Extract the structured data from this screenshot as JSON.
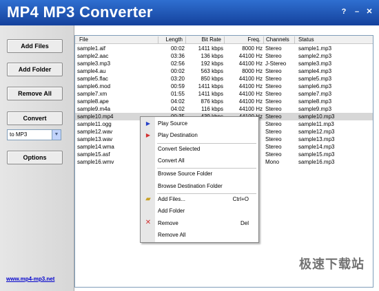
{
  "window": {
    "title": "MP4 MP3 Converter",
    "help_label": "?",
    "minimize_label": "–",
    "close_label": "✕"
  },
  "sidebar": {
    "add_files": "Add Files",
    "add_folder": "Add Folder",
    "remove_all": "Remove All",
    "convert": "Convert",
    "format_selected": "to MP3",
    "options": "Options",
    "website": "www.mp4-mp3.net"
  },
  "table": {
    "columns": [
      "File",
      "Length",
      "Bit Rate",
      "Freq.",
      "Channels",
      "Status"
    ],
    "rows": [
      {
        "file": "sample1.aif",
        "length": "00:02",
        "bitrate": "1411 kbps",
        "freq": "8000 Hz",
        "channels": "Stereo",
        "status": "sample1.mp3"
      },
      {
        "file": "sample2.aac",
        "length": "03:36",
        "bitrate": "136 kbps",
        "freq": "44100 Hz",
        "channels": "Stereo",
        "status": "sample2.mp3"
      },
      {
        "file": "sample3.mp3",
        "length": "02:56",
        "bitrate": "192 kbps",
        "freq": "44100 Hz",
        "channels": "J-Stereo",
        "status": "sample3.mp3"
      },
      {
        "file": "sample4.au",
        "length": "00:02",
        "bitrate": "563 kbps",
        "freq": "8000 Hz",
        "channels": "Stereo",
        "status": "sample4.mp3"
      },
      {
        "file": "sample5.flac",
        "length": "03:20",
        "bitrate": "850 kbps",
        "freq": "44100 Hz",
        "channels": "Stereo",
        "status": "sample5.mp3"
      },
      {
        "file": "sample6.mod",
        "length": "00:59",
        "bitrate": "1411 kbps",
        "freq": "44100 Hz",
        "channels": "Stereo",
        "status": "sample6.mp3"
      },
      {
        "file": "sample7.xm",
        "length": "01:55",
        "bitrate": "1411 kbps",
        "freq": "44100 Hz",
        "channels": "Stereo",
        "status": "sample7.mp3"
      },
      {
        "file": "sample8.ape",
        "length": "04:02",
        "bitrate": "876 kbps",
        "freq": "44100 Hz",
        "channels": "Stereo",
        "status": "sample8.mp3"
      },
      {
        "file": "sample9.m4a",
        "length": "04:02",
        "bitrate": "116 kbps",
        "freq": "44100 Hz",
        "channels": "Stereo",
        "status": "sample9.mp3"
      },
      {
        "file": "sample10.mp4",
        "length": "00:35",
        "bitrate": "439 kbps",
        "freq": "44100 Hz",
        "channels": "Stereo",
        "status": "sample10.mp3"
      },
      {
        "file": "sample11.ogg",
        "length": "",
        "bitrate": "",
        "freq": "",
        "channels": "Stereo",
        "status": "sample11.mp3"
      },
      {
        "file": "sample12.wav",
        "length": "",
        "bitrate": "",
        "freq": "",
        "channels": "Stereo",
        "status": "sample12.mp3"
      },
      {
        "file": "sample13.wav",
        "length": "",
        "bitrate": "",
        "freq": "",
        "channels": "Stereo",
        "status": "sample13.mp3"
      },
      {
        "file": "sample14.wma",
        "length": "",
        "bitrate": "",
        "freq": "",
        "channels": "Stereo",
        "status": "sample14.mp3"
      },
      {
        "file": "sample15.asf",
        "length": "",
        "bitrate": "",
        "freq": "",
        "channels": "Stereo",
        "status": "sample15.mp3"
      },
      {
        "file": "sample16.wmv",
        "length": "",
        "bitrate": "",
        "freq": "",
        "channels": "Mono",
        "status": "sample16.mp3"
      }
    ]
  },
  "context_menu": {
    "play_source": "Play Source",
    "play_destination": "Play Destination",
    "convert_selected": "Convert Selected",
    "convert_all": "Convert All",
    "browse_source": "Browse Source Folder",
    "browse_destination": "Browse Destination Folder",
    "add_files": "Add Files...",
    "add_files_shortcut": "Ctrl+O",
    "add_folder": "Add Folder",
    "remove": "Remove",
    "remove_shortcut": "Del",
    "remove_all": "Remove All"
  },
  "watermark": "极速下载站",
  "colors": {
    "titlebar": "#1f55b8",
    "selection": "#d7d7d7",
    "link": "#0000cc"
  }
}
